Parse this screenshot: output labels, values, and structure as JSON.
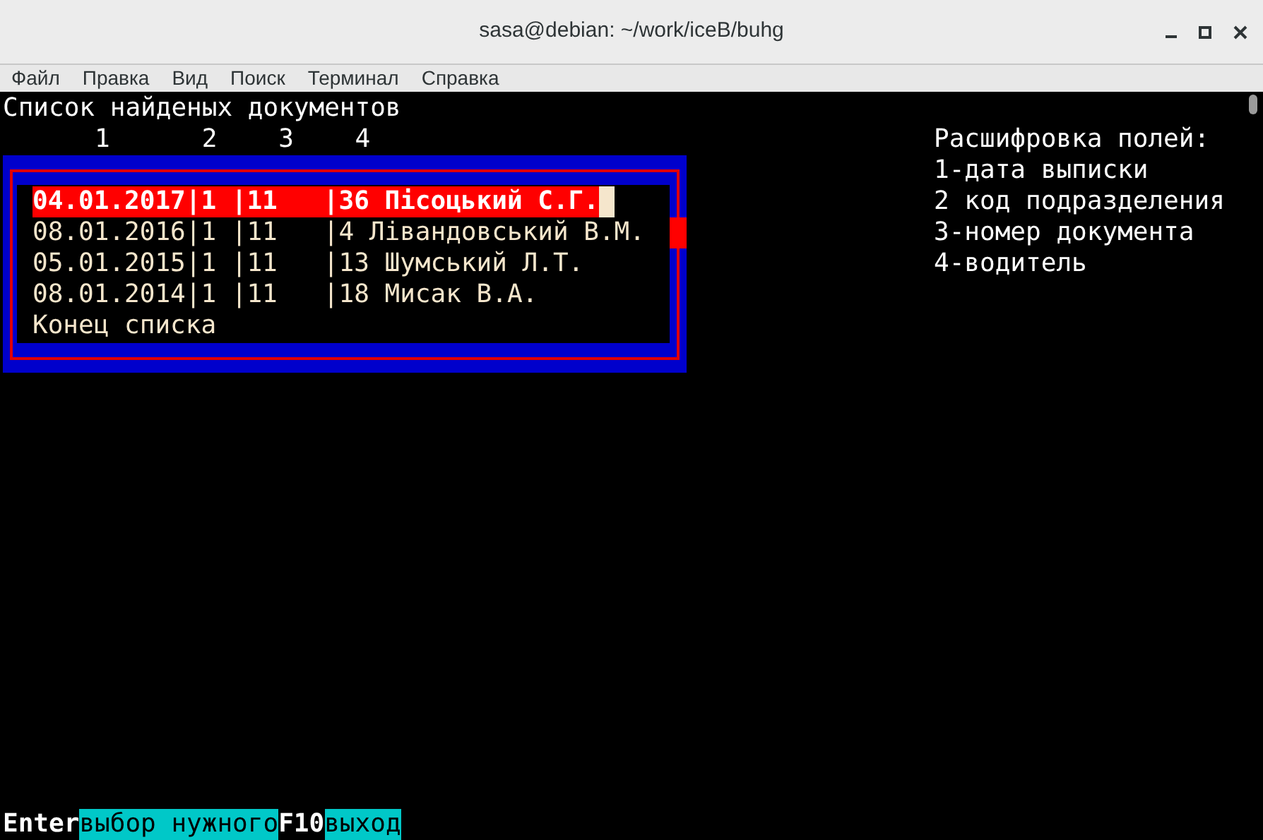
{
  "window": {
    "title": "sasa@debian: ~/work/iceB/buhg"
  },
  "menu": [
    "Файл",
    "Правка",
    "Вид",
    "Поиск",
    "Терминал",
    "Справка"
  ],
  "terminal": {
    "heading": "Список найденых документов",
    "column_numbers": [
      "1",
      "2",
      "3",
      "4"
    ],
    "rows": [
      {
        "text": "04.01.2017|1 |11   |36 Пісоцький С.Г.",
        "selected": true
      },
      {
        "text": "08.01.2016|1 |11   |4 Лівандовський В.М.",
        "selected": false
      },
      {
        "text": "05.01.2015|1 |11   |13 Шумський Л.Т.",
        "selected": false
      },
      {
        "text": "08.01.2014|1 |11   |18 Мисак В.А.",
        "selected": false
      }
    ],
    "list_end": "Конец списка",
    "legend": [
      "Расшифровка полей:",
      "1-дата выписки",
      "2 код подразделения",
      "3-номер документа",
      "4-водитель"
    ],
    "hotkeys": [
      {
        "key": "Enter",
        "action": "выбор нужного"
      },
      {
        "key": "F10",
        "action": "выход"
      }
    ]
  }
}
